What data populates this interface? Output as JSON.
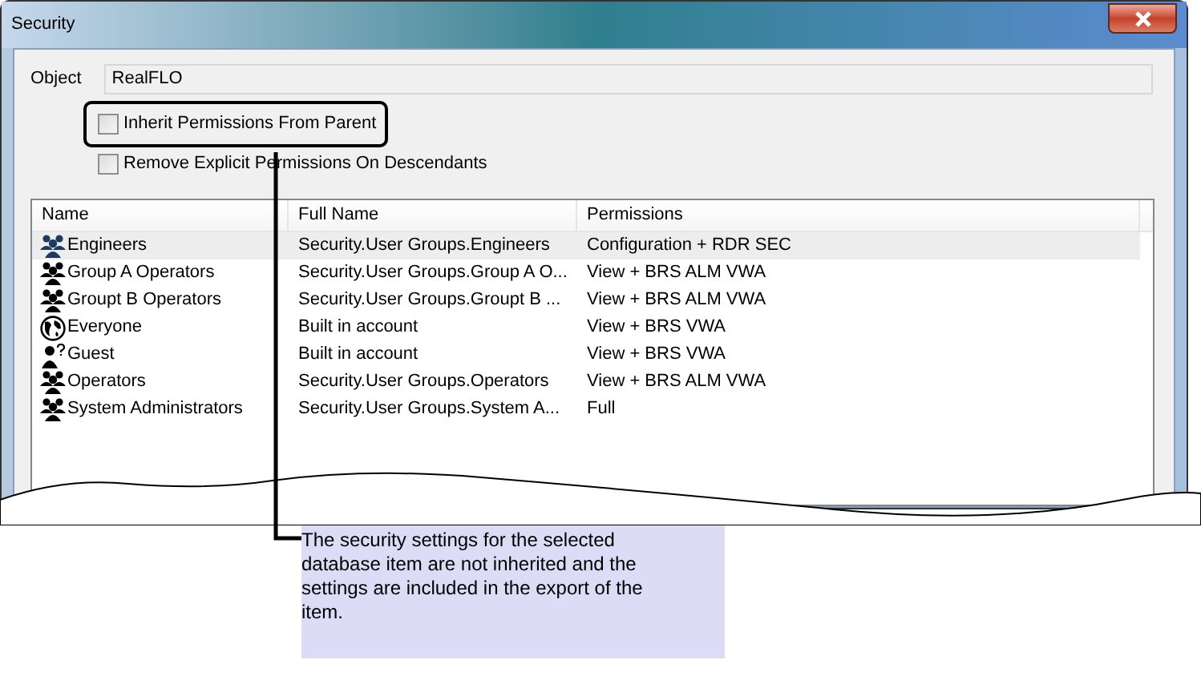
{
  "window": {
    "title": "Security"
  },
  "object": {
    "label": "Object",
    "value": "RealFLO"
  },
  "checkboxes": [
    {
      "label": "Inherit Permissions From Parent",
      "checked": false,
      "highlighted": true
    },
    {
      "label": "Remove Explicit Permissions On Descendants",
      "checked": false,
      "highlighted": false
    }
  ],
  "table": {
    "columns": [
      "Name",
      "Full Name",
      "Permissions"
    ],
    "rows": [
      {
        "kind": "group",
        "name": "Engineers",
        "full_name": "Security.User Groups.Engineers",
        "permissions": "Configuration + RDR SEC",
        "selected": true
      },
      {
        "kind": "group",
        "name": "Group A Operators",
        "full_name": "Security.User Groups.Group A O...",
        "permissions": "View + BRS ALM VWA",
        "selected": false
      },
      {
        "kind": "group",
        "name": "Groupt B Operators",
        "full_name": "Security.User Groups.Groupt B ...",
        "permissions": "View + BRS ALM VWA",
        "selected": false
      },
      {
        "kind": "world",
        "name": "Everyone",
        "full_name": "Built in account",
        "permissions": "View + BRS VWA",
        "selected": false
      },
      {
        "kind": "guest",
        "name": "Guest",
        "full_name": "Built in account",
        "permissions": "View + BRS VWA",
        "selected": false
      },
      {
        "kind": "group",
        "name": "Operators",
        "full_name": "Security.User Groups.Operators",
        "permissions": "View + BRS ALM VWA",
        "selected": false
      },
      {
        "kind": "group",
        "name": "System Administrators",
        "full_name": "Security.User Groups.System A...",
        "permissions": "Full",
        "selected": false
      }
    ]
  },
  "callout": {
    "text": "The security settings for the selected database item are not inherited and the settings are included in the export of the item."
  }
}
